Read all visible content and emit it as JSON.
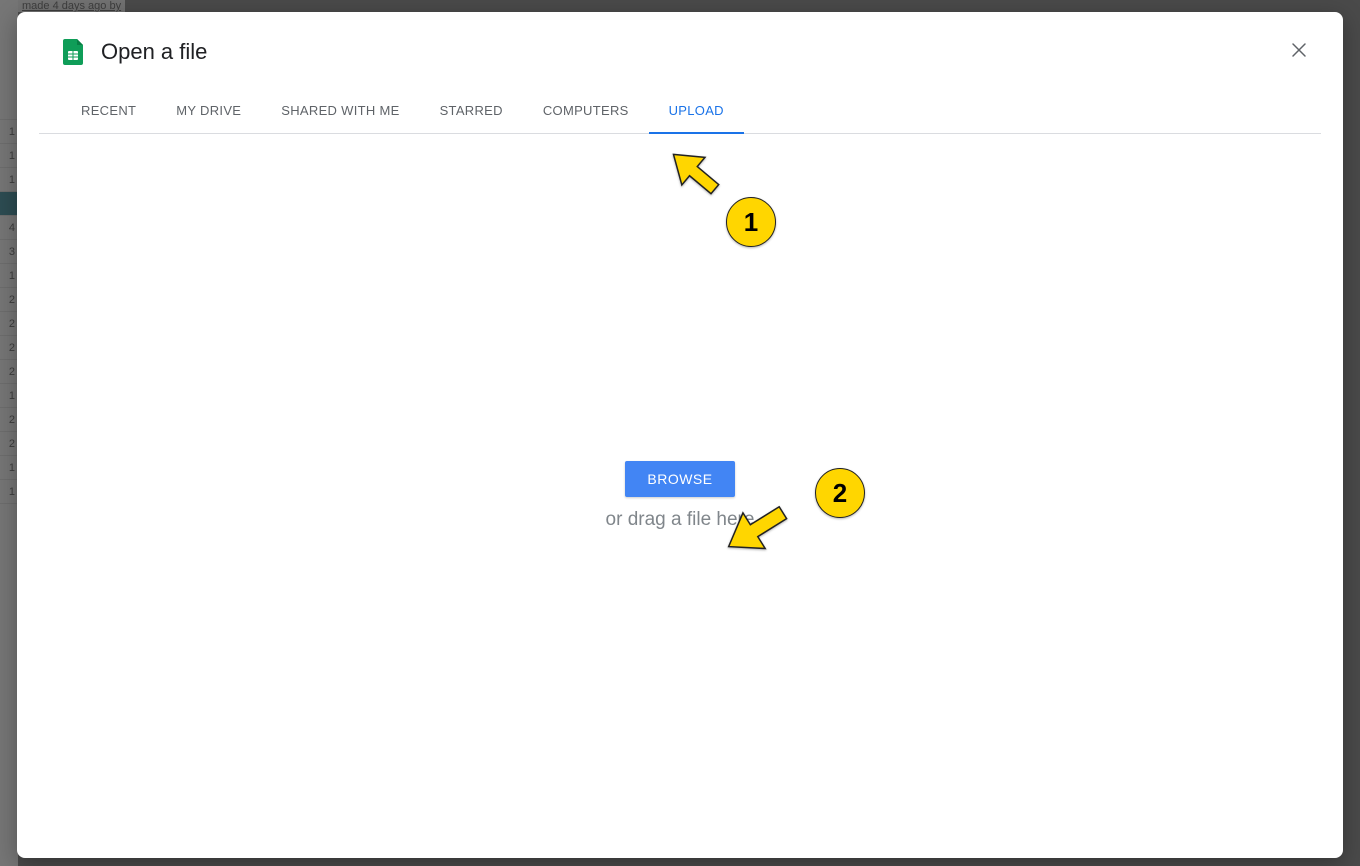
{
  "background": {
    "topline_text": "made 4 days ago by",
    "row_numbers": [
      "",
      "1",
      "1",
      "1",
      "",
      "4",
      "3",
      "1",
      "2",
      "2",
      "2",
      "2",
      "1",
      "2",
      "2",
      "1",
      "1"
    ],
    "selected_indexes": [
      4,
      17
    ]
  },
  "modal": {
    "title": "Open a file",
    "tabs": [
      {
        "label": "RECENT",
        "active": false
      },
      {
        "label": "MY DRIVE",
        "active": false
      },
      {
        "label": "SHARED WITH ME",
        "active": false
      },
      {
        "label": "STARRED",
        "active": false
      },
      {
        "label": "COMPUTERS",
        "active": false
      },
      {
        "label": "UPLOAD",
        "active": true
      }
    ],
    "upload": {
      "browse_label": "BROWSE",
      "drag_hint": "or drag a file here"
    }
  },
  "annotations": {
    "arrow1_badge": "1",
    "arrow2_badge": "2"
  },
  "colors": {
    "accent": "#1a73e8",
    "button": "#4285f4",
    "annotation_fill": "#ffd600",
    "sheets_green": "#0f9d58"
  }
}
